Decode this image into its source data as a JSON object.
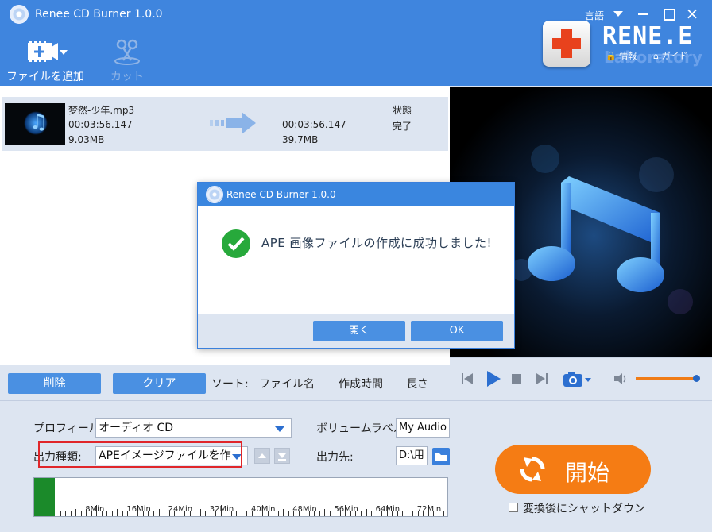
{
  "titlebar": {
    "app_title": "Renee CD Burner 1.0.0",
    "language_label": "言語",
    "minimize_icon": "minimize-icon",
    "maximize_icon": "maximize-icon",
    "close_symbol": "×"
  },
  "toolbar": {
    "add_file_label": "ファイルを追加",
    "cut_label": "カット"
  },
  "branding": {
    "logo_text": "RENE.E",
    "logo_sub": "Laboratory",
    "login_label": "情報",
    "guide_label": "ガイド"
  },
  "file_list": {
    "items": [
      {
        "name": "梦然-少年.mp3",
        "source_duration": "00:03:56.147",
        "source_size": "9.03MB",
        "output_duration": "00:03:56.147",
        "output_size": "39.7MB",
        "status_header": "状態",
        "status": "完了"
      }
    ]
  },
  "list_actions": {
    "delete_label": "削除",
    "clear_label": "クリア",
    "sort_label": "ソート:",
    "sort_options": [
      "ファイル名",
      "作成時間",
      "長さ"
    ]
  },
  "player": {
    "volume_level": 0.95,
    "icons": [
      "skip-back-icon",
      "play-icon",
      "stop-icon",
      "skip-forward-icon",
      "camera-icon",
      "volume-icon"
    ]
  },
  "settings": {
    "profile_label": "プロフィール:",
    "profile_value": "オーディオ CD",
    "output_type_label": "出力種類:",
    "output_type_value": "APEイメージファイルを作",
    "volume_label_label": "ボリュームラベル:",
    "volume_label_value": "My Audio CD",
    "output_dest_label": "出力先:",
    "output_dest_value": "D:\\用",
    "timeline_used_minutes": 3.94,
    "timeline_ticks": [
      "8Min",
      "16Min",
      "24Min",
      "32Min",
      "40Min",
      "48Min",
      "56Min",
      "64Min",
      "72Min"
    ],
    "start_label": "開始",
    "shutdown_label": "変換後にシャットダウン"
  },
  "dialog": {
    "title": "Renee CD Burner 1.0.0",
    "message": "APE 画像ファイルの作成に成功しました!",
    "open_label": "開く",
    "ok_label": "OK"
  },
  "colors": {
    "accent": "#3f85de",
    "start_button": "#f57c14",
    "success": "#27a93b",
    "highlight_box": "#e0262a"
  }
}
